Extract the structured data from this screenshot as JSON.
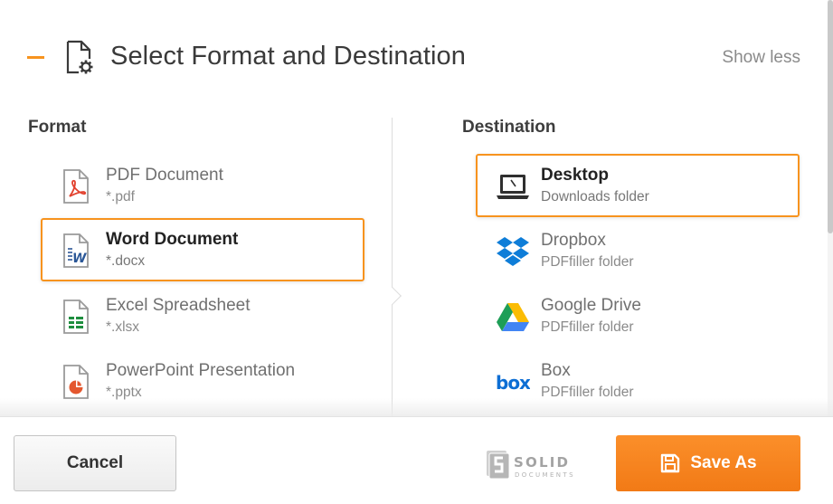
{
  "header": {
    "title": "Select Format and Destination",
    "show_less_label": "Show less",
    "collapse_icon": "minus-icon",
    "title_icon": "document-settings-icon"
  },
  "format": {
    "heading": "Format",
    "items": [
      {
        "name": "PDF Document",
        "ext": "*.pdf",
        "icon": "pdf-file-icon",
        "selected": false
      },
      {
        "name": "Word Document",
        "ext": "*.docx",
        "icon": "word-file-icon",
        "selected": true
      },
      {
        "name": "Excel Spreadsheet",
        "ext": "*.xlsx",
        "icon": "excel-file-icon",
        "selected": false
      },
      {
        "name": "PowerPoint Presentation",
        "ext": "*.pptx",
        "icon": "powerpoint-file-icon",
        "selected": false
      }
    ]
  },
  "destination": {
    "heading": "Destination",
    "items": [
      {
        "name": "Desktop",
        "folder": "Downloads folder",
        "icon": "laptop-icon",
        "selected": true
      },
      {
        "name": "Dropbox",
        "folder": "PDFfiller folder",
        "icon": "dropbox-icon",
        "selected": false
      },
      {
        "name": "Google Drive",
        "folder": "PDFfiller folder",
        "icon": "google-drive-icon",
        "selected": false
      },
      {
        "name": "Box",
        "folder": "PDFfiller folder",
        "icon": "box-icon",
        "selected": false
      }
    ]
  },
  "footer": {
    "cancel_label": "Cancel",
    "save_label": "Save As",
    "save_icon": "floppy-disk-icon",
    "brand_logo_text": "SOLID DOCUMENTS"
  },
  "colors": {
    "accent": "#f7931e",
    "save_button": "#f7831f",
    "text_dark": "#333333",
    "text_muted": "#8a8a8a"
  }
}
